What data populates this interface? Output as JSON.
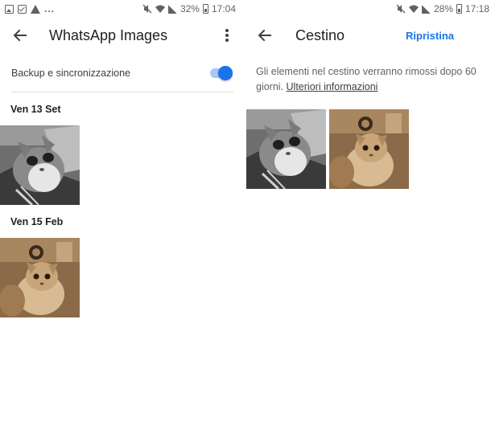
{
  "left_screen": {
    "statusbar": {
      "left_icons": [
        "gallery-icon",
        "checkbox-icon",
        "warning-icon"
      ],
      "ellipsis": "...",
      "battery_percent": "32%",
      "time": "17:04"
    },
    "appbar": {
      "title": "WhatsApp Images"
    },
    "backup": {
      "label": "Backup e sincronizzazione",
      "enabled": true
    },
    "groups": [
      {
        "date": "Ven 13 Set",
        "photos": [
          "grey-tabby-cat-photo"
        ]
      },
      {
        "date": "Ven 15 Feb",
        "photos": [
          "sepia-kitten-photo"
        ]
      }
    ]
  },
  "right_screen": {
    "statusbar": {
      "battery_percent": "28%",
      "time": "17:18"
    },
    "appbar": {
      "title": "Cestino",
      "action": "Ripristina"
    },
    "info_text": "Gli elementi nel cestino verranno rimossi dopo 60 giorni.",
    "info_link": "Ulteriori informazioni",
    "photos": [
      "grey-tabby-cat-photo",
      "sepia-kitten-photo"
    ]
  },
  "colors": {
    "accent": "#1a73e8",
    "toggle_track": "#a8c7fa",
    "divider": "#dadce0"
  }
}
